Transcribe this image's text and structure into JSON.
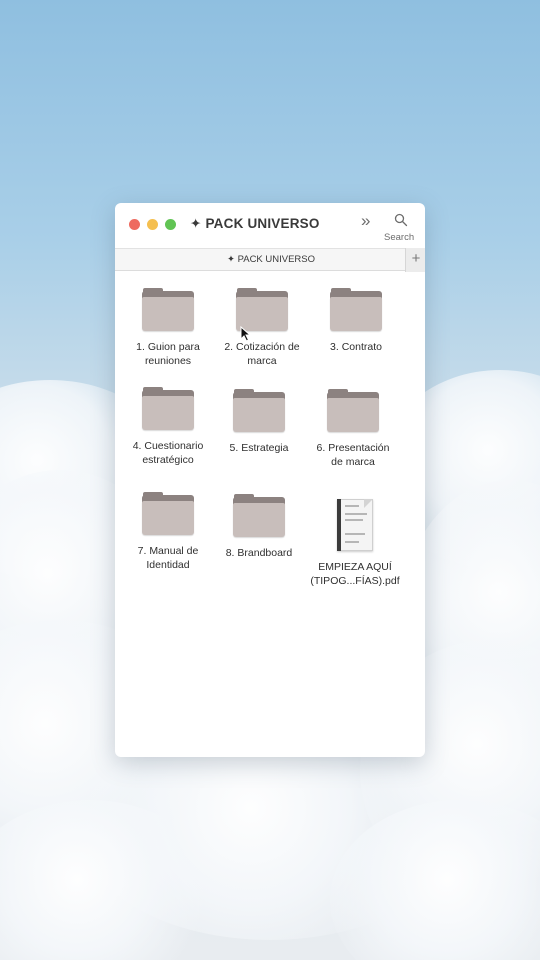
{
  "window": {
    "title": "✦ PACK UNIVERSO",
    "search_label": "Search",
    "tab_label": "✦ PACK UNIVERSO",
    "add_tab_label": "+",
    "more_label": "»"
  },
  "items": [
    {
      "type": "folder",
      "label": "1. Guion para\nreuniones"
    },
    {
      "type": "folder",
      "label": "2. Cotización de\nmarca"
    },
    {
      "type": "folder",
      "label": "3. Contrato"
    },
    {
      "type": "folder",
      "label": "4. Cuestionario\nestratégico"
    },
    {
      "type": "folder",
      "label": "5. Estrategia"
    },
    {
      "type": "folder",
      "label": "6. Presentación\nde marca"
    },
    {
      "type": "folder",
      "label": "7. Manual de\nIdentidad"
    },
    {
      "type": "folder",
      "label": "8. Brandboard"
    },
    {
      "type": "pdf",
      "label": "EMPIEZA AQUÍ\n(TIPOG...FÍAS).pdf"
    }
  ],
  "colors": {
    "folder_front": "#c8bebb",
    "folder_back": "#8c8280",
    "close": "#ee6a5f",
    "minimize": "#f5bf4f",
    "zoom": "#61c454"
  }
}
